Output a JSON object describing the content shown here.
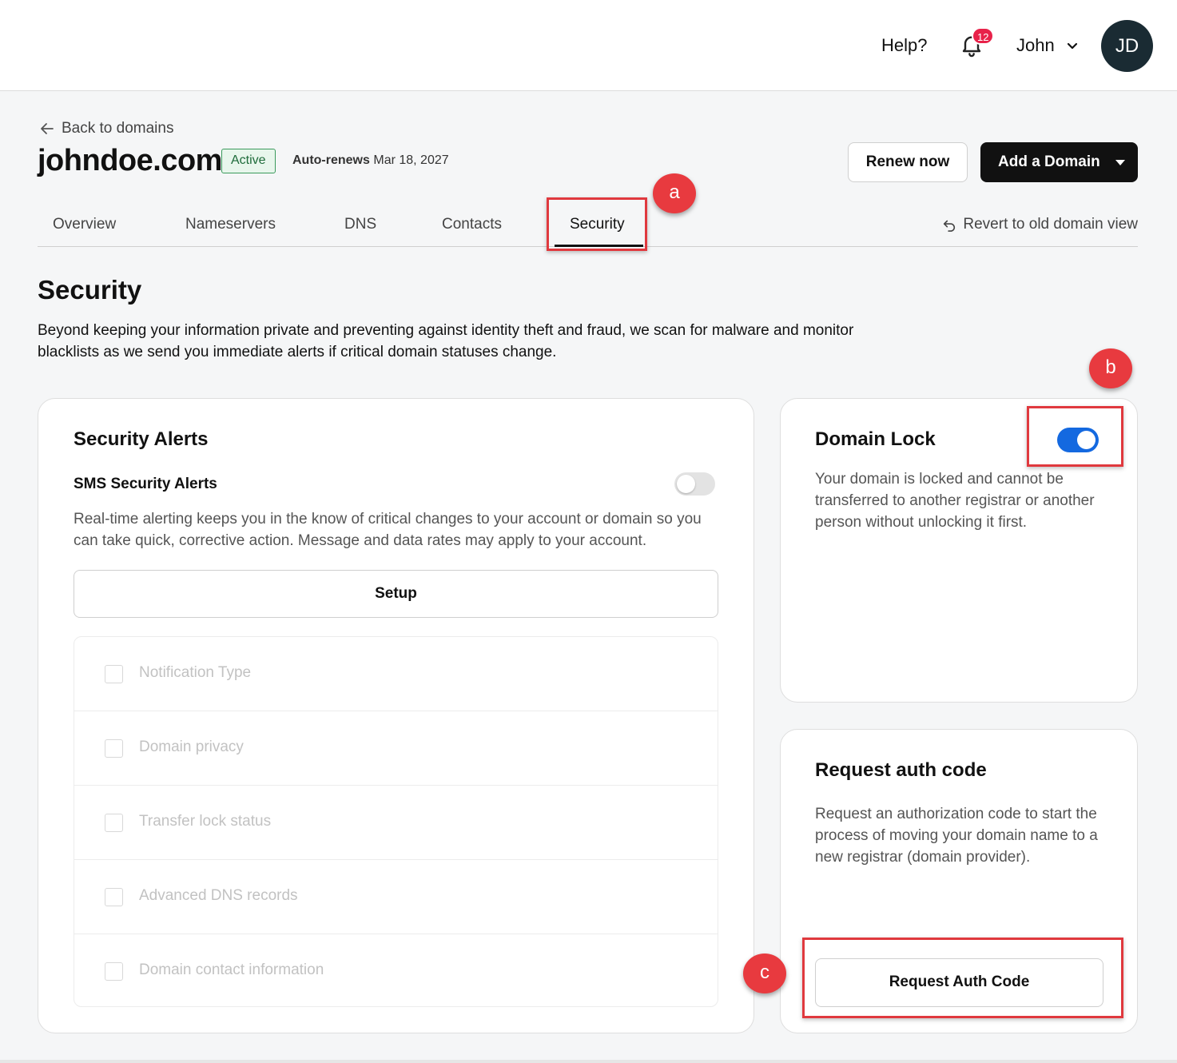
{
  "header": {
    "help_label": "Help?",
    "notification_count": "12",
    "user_name": "John",
    "avatar_initials": "JD"
  },
  "domain": {
    "back_label": "Back to domains",
    "name": "johndoe.com",
    "status": "Active",
    "autorenew_label": "Auto-renews",
    "autorenew_date": "Mar 18, 2027",
    "renew_button": "Renew now",
    "add_domain_button": "Add a Domain"
  },
  "tabs": [
    {
      "label": "Overview"
    },
    {
      "label": "Nameservers"
    },
    {
      "label": "DNS"
    },
    {
      "label": "Contacts"
    },
    {
      "label": "Security",
      "active": true
    }
  ],
  "revert_label": "Revert to old domain view",
  "security": {
    "heading": "Security",
    "description": "Beyond keeping your information private and preventing against identity theft and fraud, we scan for malware and monitor blacklists as we send you immediate alerts if critical domain statuses change."
  },
  "alerts_card": {
    "title": "Security Alerts",
    "sms_title": "SMS Security Alerts",
    "sms_enabled": false,
    "sms_description": "Real-time alerting keeps you in the know of critical changes to your account or domain so you can take quick, corrective action. Message and data rates may apply to your account.",
    "setup_button": "Setup",
    "notification_types": [
      "Notification Type",
      "Domain privacy",
      "Transfer lock status",
      "Advanced DNS records",
      "Domain contact information"
    ]
  },
  "lock_card": {
    "title": "Domain Lock",
    "locked": true,
    "description": "Your domain is locked and cannot be transferred to another registrar or another person without unlocking it first."
  },
  "auth_card": {
    "title": "Request auth code",
    "description": "Request an authorization code to start the process of moving your domain name to a new registrar (domain provider).",
    "button": "Request Auth Code"
  },
  "annotations": {
    "a": "a",
    "b": "b",
    "c": "c",
    "highlight_color": "#e0393e"
  }
}
